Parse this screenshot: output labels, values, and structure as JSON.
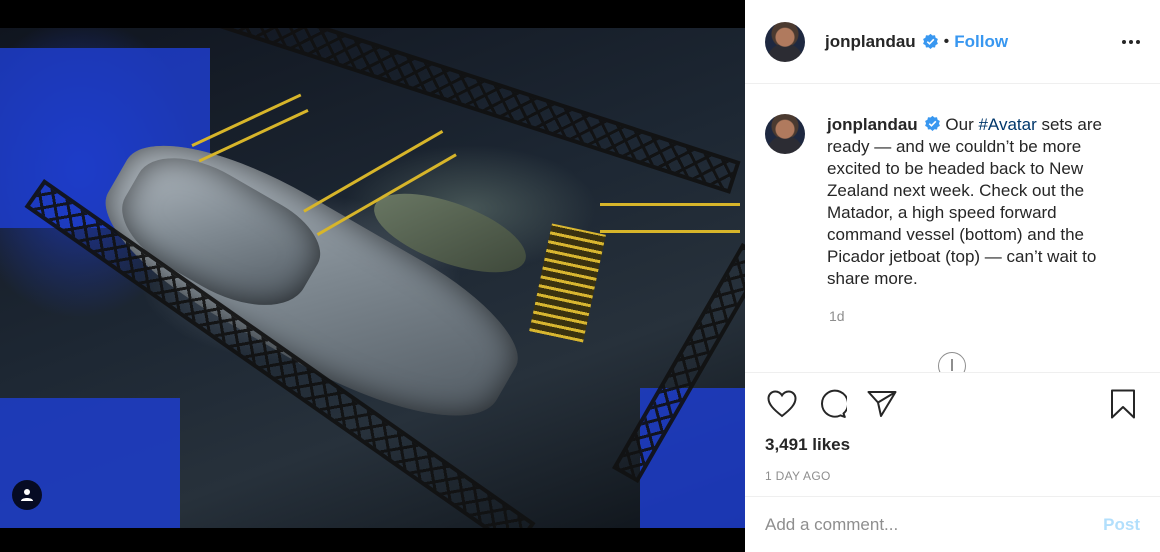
{
  "post": {
    "username": "jonplandau",
    "follow_label": "Follow",
    "separator": "•",
    "verified_icon": "verified-badge-icon",
    "more_icon": "more-options-icon"
  },
  "caption": {
    "username": "jonplandau",
    "text_before": "Our ",
    "hashtag": "#Avatar",
    "text_after": " sets are ready — and we couldn’t be more excited to be headed back to New Zealand next week. Check out the Matador, a high speed forward command vessel (bottom) and the Picador jetboat (top) — can’t wait to share more.",
    "time_ago": "1d"
  },
  "actions": {
    "icons": [
      "heart-icon",
      "comment-icon",
      "share-icon",
      "bookmark-icon"
    ],
    "likes": "3,491 likes",
    "date": "1 DAY AGO"
  },
  "comment": {
    "placeholder": "Add a comment...",
    "post_label": "Post"
  },
  "colors": {
    "accent": "#3897f0",
    "post_disabled": "#b2dffc",
    "hashtag": "#00376b",
    "muted": "#8e8e8e"
  }
}
